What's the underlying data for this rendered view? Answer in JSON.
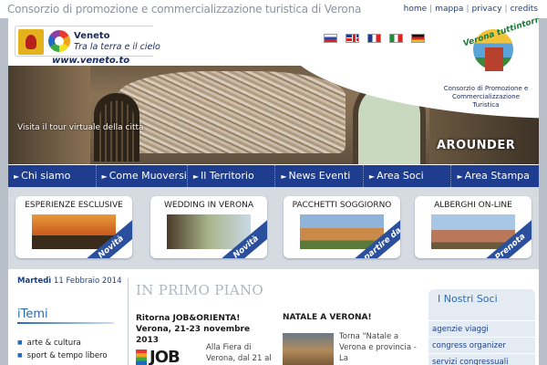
{
  "topbar": {
    "tagline": "Consorzio di promozione e commercializzazione turistica di Verona",
    "links": [
      "home",
      "mappa",
      "privacy",
      "credits"
    ],
    "separator": "|"
  },
  "header": {
    "brand_name": "Veneto",
    "brand_slogan": "Tra la terra e il cielo",
    "site_url": "www.veneto.to",
    "flags": [
      "russian-flag",
      "uk-flag",
      "french-flag",
      "italian-flag",
      "german-flag"
    ],
    "tour_caption": "Visita il tour virtuale della città",
    "arounder": "AROUNDER",
    "badge_text": "Verona tuttintorno",
    "consorzio_small": "Consorzio di Promozione e Commercializzazione Turistica"
  },
  "nav": {
    "items": [
      "Chi siamo",
      "Come Muoversi",
      "Il Territorio",
      "News  Eventi",
      "Area Soci",
      "Area Stampa"
    ],
    "arrow": "►"
  },
  "cards": [
    {
      "title": "ESPERIENZE ESCLUSIVE",
      "ribbon": "Novità"
    },
    {
      "title": "WEDDING IN VERONA",
      "ribbon": "Novità"
    },
    {
      "title": "PACCHETTI SOGGIORNO",
      "ribbon": "A partire da"
    },
    {
      "title": "ALBERGHI ON-LINE",
      "ribbon": "Prenota"
    }
  ],
  "sidebar": {
    "date_day": "Martedì",
    "date_rest": "11 Febbraio 2014",
    "itemi_title": "iTemi",
    "itemi_items": [
      "arte & cultura",
      "sport & tempo libero"
    ]
  },
  "main": {
    "section_title": "IN PRIMO PIANO",
    "news1_title": "Ritorna JOB&ORIENTA! Verona, 21-23 novembre 2013",
    "news1_logo": "JOB",
    "news1_text": "Alla Fiera di Verona, dal 21 al",
    "news2_title": "NATALE A VERONA!",
    "news2_text": "Torna \"Natale a Verona e provincia - La"
  },
  "soci": {
    "title": "I Nostri Soci",
    "items": [
      "agenzie viaggi",
      "congress organizer",
      "servizi congressuali"
    ]
  },
  "colors": {
    "nav_blue": "#1f3d8f",
    "link_blue": "#1b3f86",
    "accent_blue": "#2a6bb7",
    "page_bg": "#b9bfc8"
  }
}
